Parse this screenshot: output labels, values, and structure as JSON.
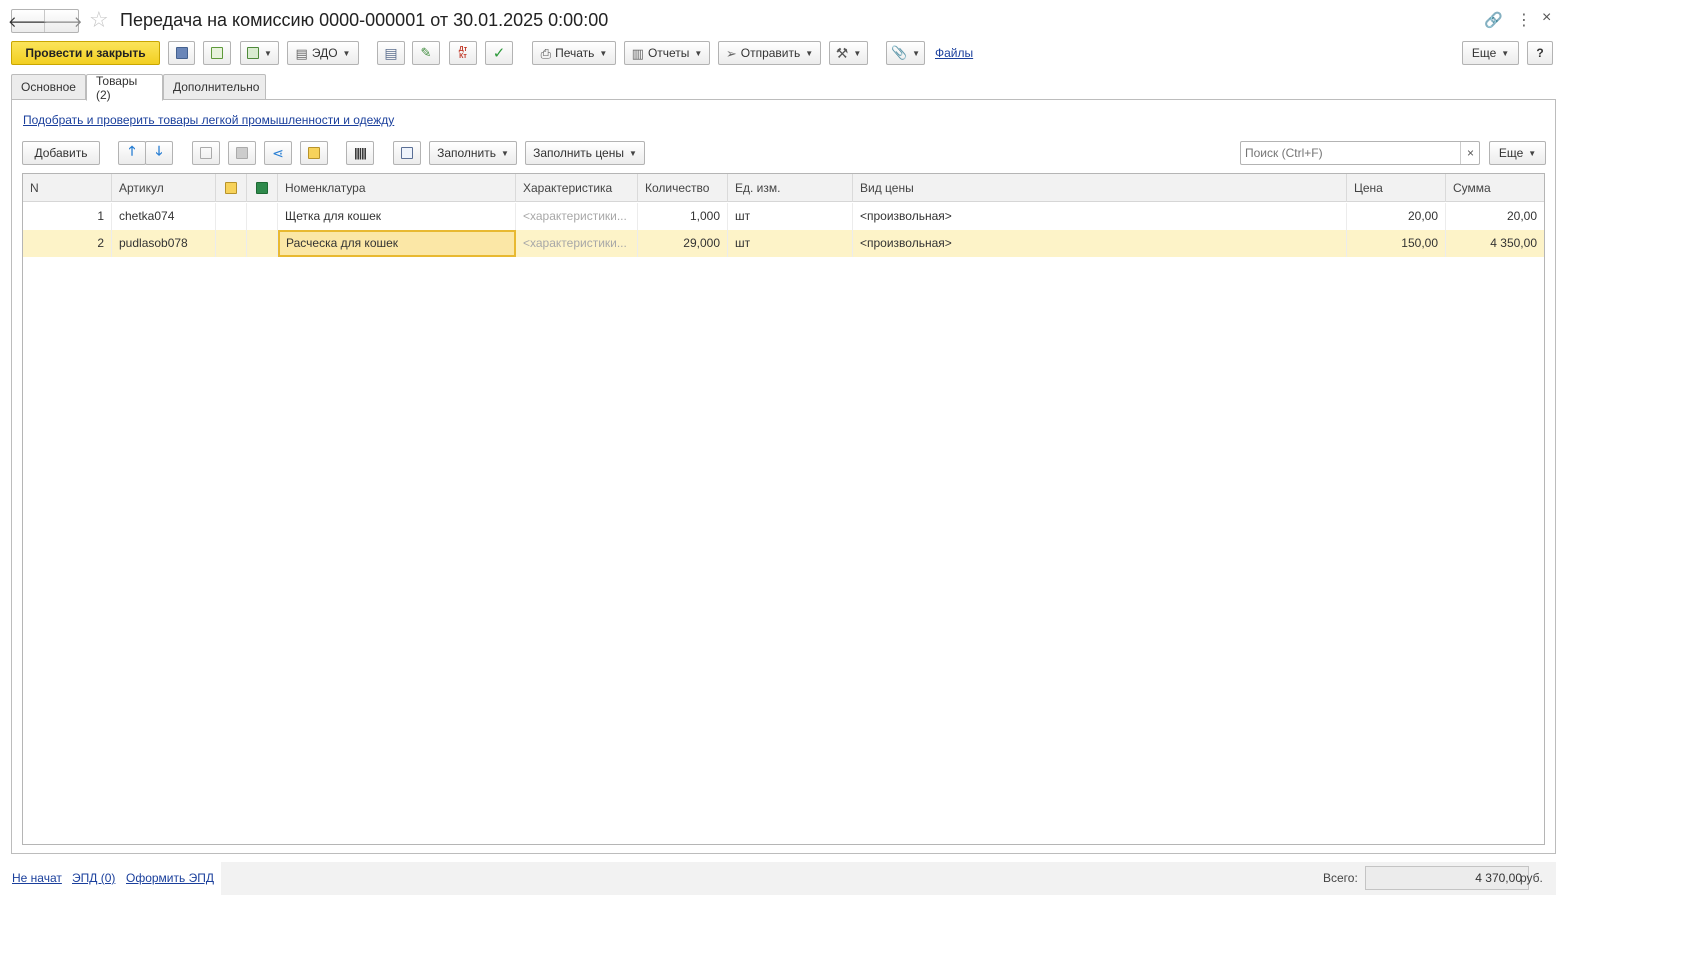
{
  "window": {
    "title": "Передача на комиссию 0000-000001 от 30.01.2025 0:00:00"
  },
  "toolbar": {
    "post_close_label": "Провести и закрыть",
    "edo_label": "ЭДО",
    "print_label": "Печать",
    "reports_label": "Отчеты",
    "send_label": "Отправить",
    "files_label": "Файлы",
    "more_label": "Еще",
    "help_label": "?",
    "dtkt_label": "Дт Кт"
  },
  "tabs": [
    {
      "label": "Основное"
    },
    {
      "label": "Товары (2)"
    },
    {
      "label": "Дополнительно"
    }
  ],
  "goods": {
    "pick_link": "Подобрать и проверить товары легкой промышленности и одежду",
    "add_label": "Добавить",
    "fill_label": "Заполнить",
    "fill_prices_label": "Заполнить цены",
    "search_placeholder": "Поиск (Ctrl+F)",
    "search_clear": "×",
    "more_label": "Еще",
    "columns": [
      "N",
      "Артикул",
      "",
      "",
      "Номенклатура",
      "Характеристика",
      "Количество",
      "Ед. изм.",
      "Вид цены",
      "Цена",
      "Сумма"
    ],
    "rows": [
      {
        "n": "1",
        "article": "chetka074",
        "item": "Щетка для кошек",
        "characteristic": "<характеристики...",
        "qty": "1,000",
        "unit": "шт",
        "price_type": "<произвольная>",
        "price": "20,00",
        "sum": "20,00"
      },
      {
        "n": "2",
        "article": "pudlasob078",
        "item": "Расческа для кошек",
        "characteristic": "<характеристики...",
        "qty": "29,000",
        "unit": "шт",
        "price_type": "<произвольная>",
        "price": "150,00",
        "sum": "4 350,00"
      }
    ]
  },
  "footer": {
    "status_link": "Не начат",
    "epd_link": "ЭПД (0)",
    "make_epd_link": "Оформить ЭПД",
    "total_label": "Всего:",
    "total_value": "4 370,00",
    "currency": "руб."
  },
  "colors": {
    "primary_button": "#f7d83b",
    "selected_row": "#fdf3c8",
    "link": "#1a3f9c"
  }
}
